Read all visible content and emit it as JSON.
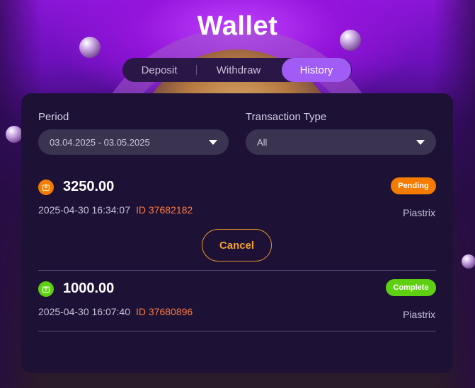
{
  "title": "Wallet",
  "tabs": [
    {
      "label": "Deposit",
      "active": false
    },
    {
      "label": "Withdraw",
      "active": false
    },
    {
      "label": "History",
      "active": true
    }
  ],
  "filters": {
    "period": {
      "label": "Period",
      "value": "03.04.2025 - 03.05.2025"
    },
    "type": {
      "label": "Transaction Type",
      "value": "All"
    }
  },
  "transactions": [
    {
      "amount": "3250.00",
      "datetime": "2025-04-30 16:34:07",
      "id": "ID 37682182",
      "status": "Pending",
      "provider": "Piastrix",
      "icon": "withdraw-arrow-icon",
      "action": "Cancel"
    },
    {
      "amount": "1000.00",
      "datetime": "2025-04-30 16:07:40",
      "id": "ID 37680896",
      "status": "Complete",
      "provider": "Piastrix",
      "icon": "deposit-arrow-icon"
    }
  ],
  "colors": {
    "accent": "#a15cf5",
    "pending": "#f57c00",
    "complete": "#5fcf12",
    "id_text": "#ff7a3a",
    "cancel_border": "#e0902a"
  }
}
